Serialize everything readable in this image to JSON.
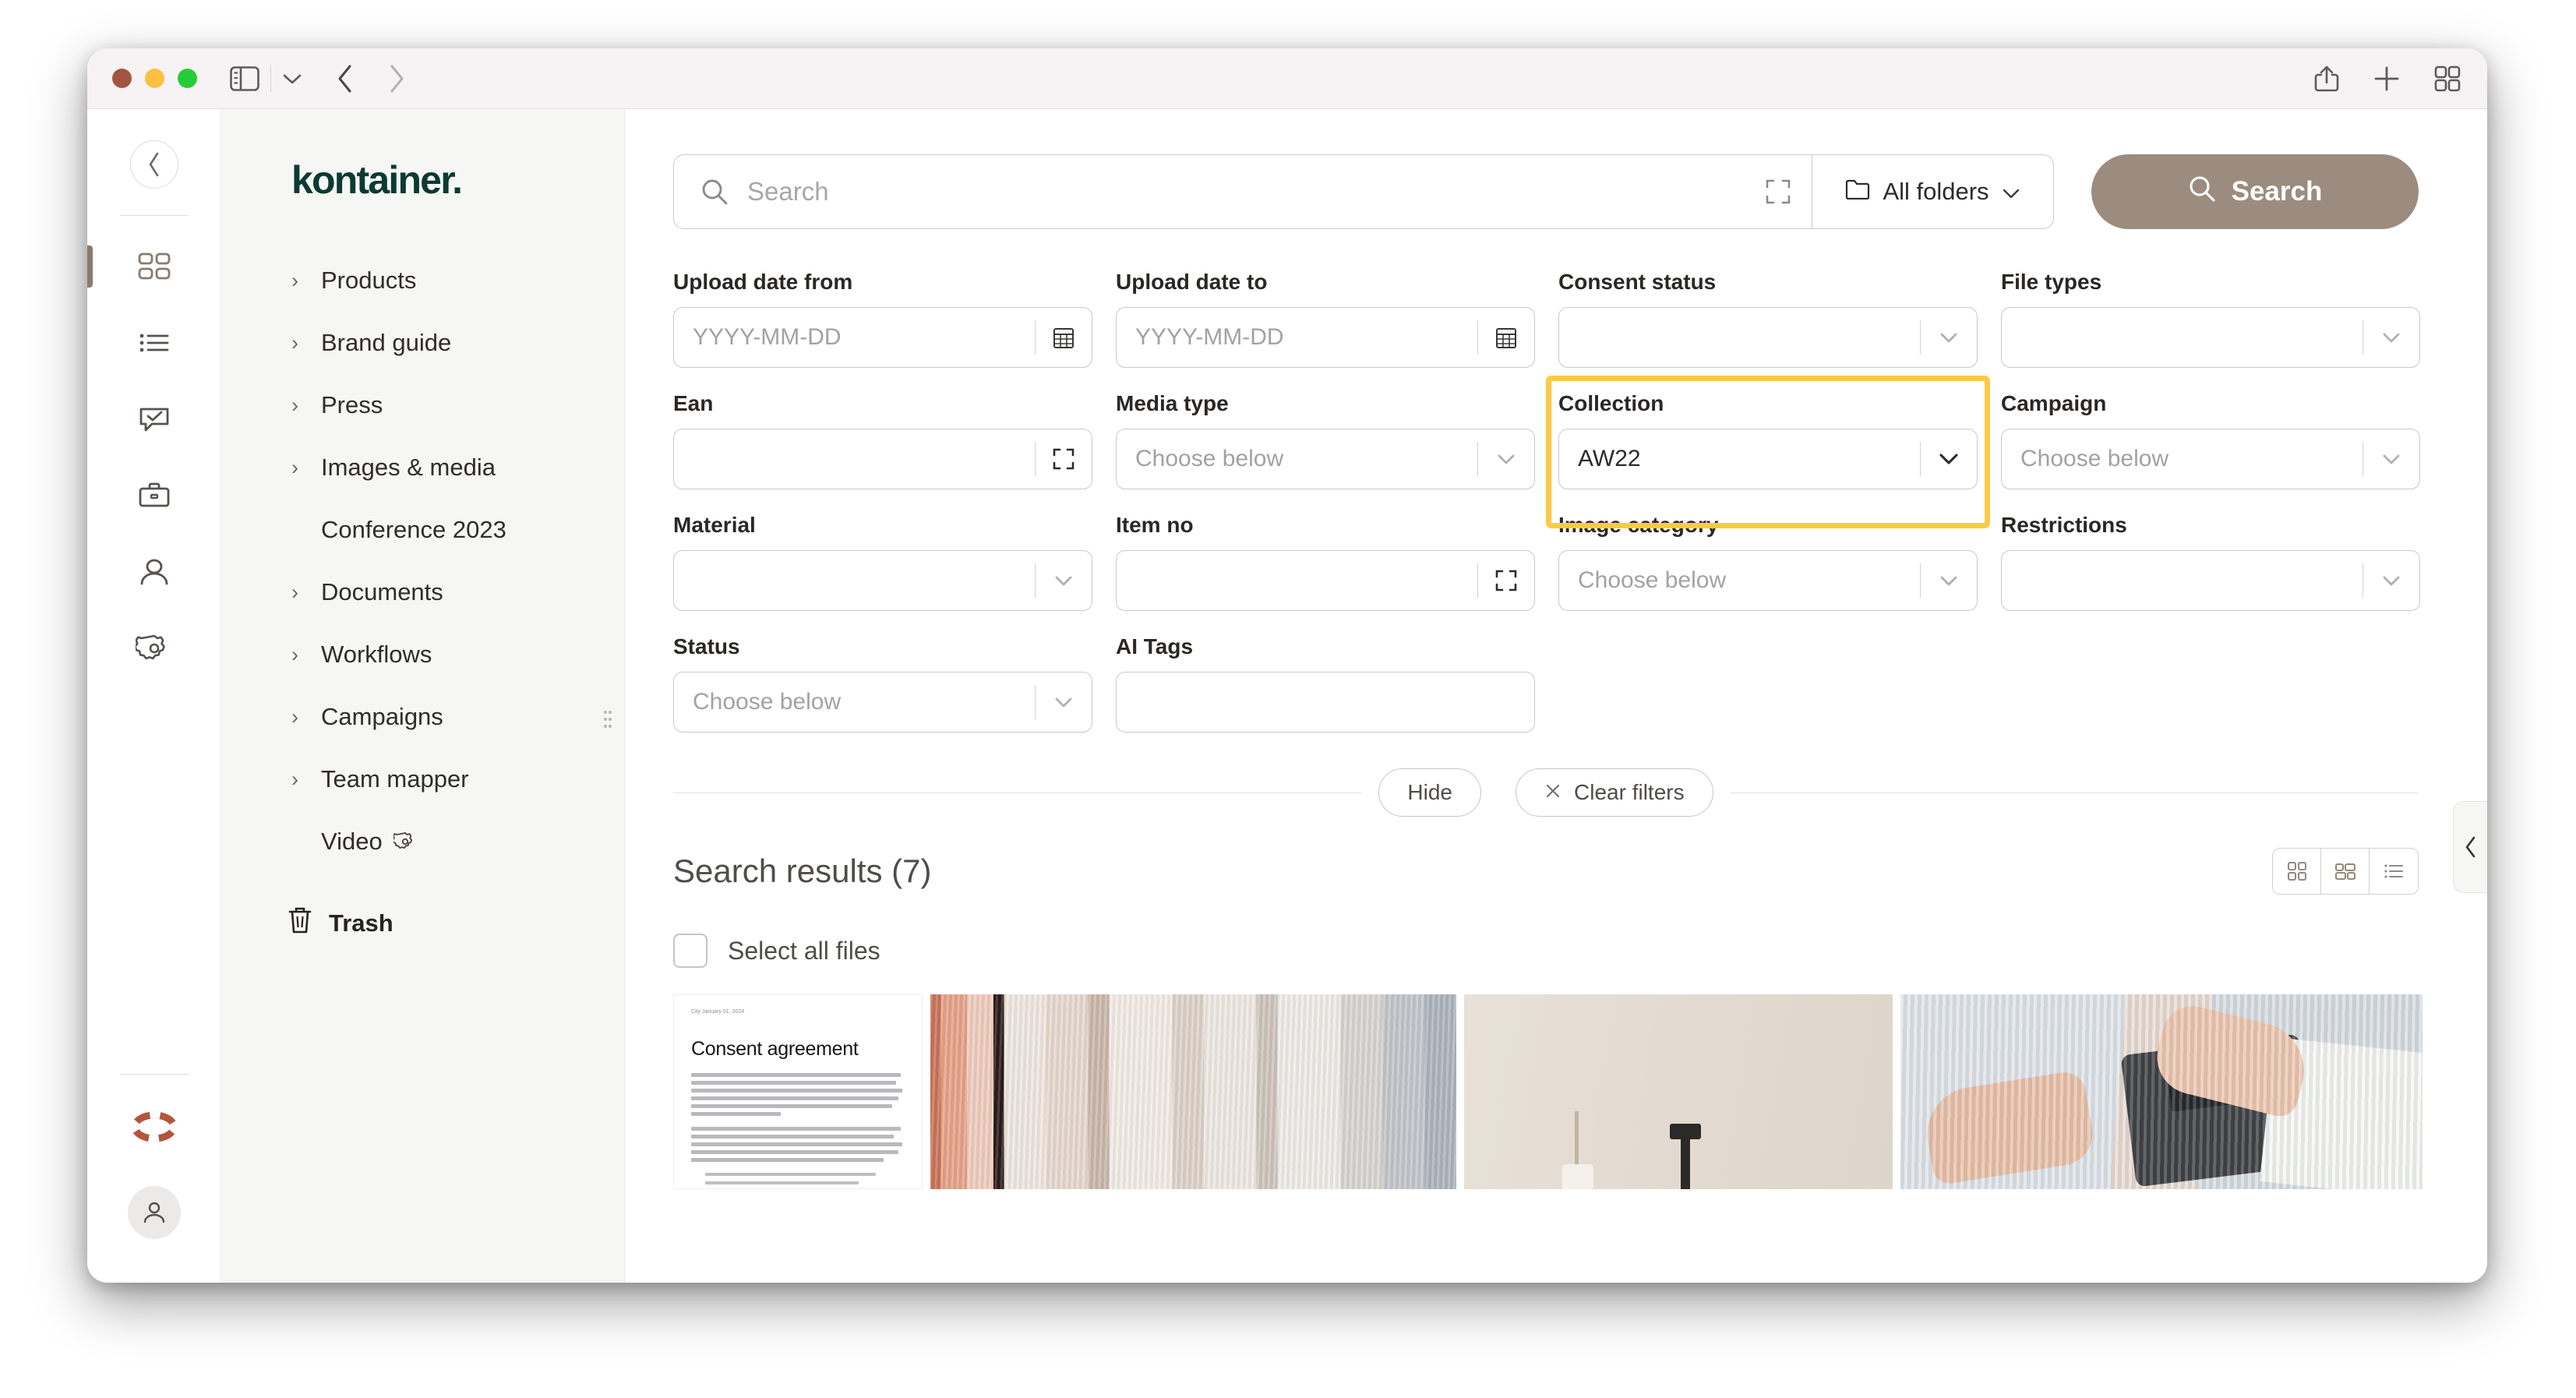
{
  "browser": {
    "traffic_lights": [
      "close",
      "minimize",
      "maximize"
    ],
    "sidebar_toggle_icon": "sidebar-icon",
    "sidebar_dropdown_icon": "chevron-down-icon",
    "back_icon": "chevron-left-icon",
    "forward_icon": "chevron-right-icon",
    "share_icon": "share-icon",
    "new_tab_icon": "plus-icon",
    "tab_overview_icon": "grid-icon"
  },
  "rail": {
    "collapse_icon": "chevron-left-icon",
    "items": [
      {
        "name": "dashboard",
        "icon": "grid-icon",
        "active": true
      },
      {
        "name": "lists",
        "icon": "list-icon",
        "active": false
      },
      {
        "name": "approvals",
        "icon": "comment-check-icon",
        "active": false
      },
      {
        "name": "briefcase",
        "icon": "briefcase-icon",
        "active": false
      },
      {
        "name": "users",
        "icon": "user-icon",
        "active": false
      },
      {
        "name": "settings",
        "icon": "gear-icon",
        "active": false
      }
    ],
    "support_icon": "lifebuoy-icon",
    "support_color": "#b3563c",
    "account_icon": "user-icon"
  },
  "sidebar": {
    "brand": "kontainer.",
    "brand_color": "#0c3a33",
    "items": [
      {
        "label": "Products",
        "expandable": true
      },
      {
        "label": "Brand guide",
        "expandable": true
      },
      {
        "label": "Press",
        "expandable": true
      },
      {
        "label": "Images & media",
        "expandable": true
      },
      {
        "label": "Conference 2023",
        "expandable": false
      },
      {
        "label": "Documents",
        "expandable": true
      },
      {
        "label": "Workflows",
        "expandable": true
      },
      {
        "label": "Campaigns",
        "expandable": true
      },
      {
        "label": "Team mapper",
        "expandable": true
      },
      {
        "label": "Video",
        "expandable": false,
        "gear": true
      }
    ],
    "trash": {
      "label": "Trash",
      "icon": "trash-icon"
    },
    "drag_handle_icon": "drag-dots-icon"
  },
  "search": {
    "placeholder": "Search",
    "value": "",
    "search_icon": "search-icon",
    "expand_icon": "expand-icon",
    "folder_icon": "folder-icon",
    "folder_label": "All folders",
    "folder_caret_icon": "chevron-down-icon",
    "button_label": "Search",
    "button_icon": "search-icon",
    "button_color": "#9b8c7f"
  },
  "filters": {
    "rows": [
      [
        {
          "label": "Upload date from",
          "value": "",
          "placeholder": "YYYY-MM-DD",
          "affix": "calendar-icon",
          "type": "date"
        },
        {
          "label": "Upload date to",
          "value": "",
          "placeholder": "YYYY-MM-DD",
          "affix": "calendar-icon",
          "type": "date"
        },
        {
          "label": "Consent status",
          "value": "",
          "placeholder": "",
          "affix": "chevron-down-icon",
          "type": "select"
        },
        {
          "label": "File types",
          "value": "",
          "placeholder": "",
          "affix": "chevron-down-icon",
          "type": "select"
        }
      ],
      [
        {
          "label": "Ean",
          "value": "",
          "placeholder": "",
          "affix": "expand-icon",
          "type": "text"
        },
        {
          "label": "Media type",
          "value": "",
          "placeholder": "Choose below",
          "affix": "chevron-down-icon",
          "type": "select"
        },
        {
          "label": "Collection",
          "value": "AW22",
          "placeholder": "",
          "affix": "chevron-down-icon",
          "type": "select",
          "highlighted": true
        },
        {
          "label": "Campaign",
          "value": "",
          "placeholder": "Choose below",
          "affix": "chevron-down-icon",
          "type": "select"
        }
      ],
      [
        {
          "label": "Material",
          "value": "",
          "placeholder": "",
          "affix": "chevron-down-icon",
          "type": "select"
        },
        {
          "label": "Item no",
          "value": "",
          "placeholder": "",
          "affix": "expand-icon",
          "type": "text"
        },
        {
          "label": "Image category",
          "value": "",
          "placeholder": "Choose below",
          "affix": "chevron-down-icon",
          "type": "select"
        },
        {
          "label": "Restrictions",
          "value": "",
          "placeholder": "",
          "affix": "chevron-down-icon",
          "type": "select"
        }
      ],
      [
        {
          "label": "Status",
          "value": "",
          "placeholder": "Choose below",
          "affix": "chevron-down-icon",
          "type": "select"
        },
        {
          "label": "AI Tags",
          "value": "",
          "placeholder": "",
          "affix": "",
          "type": "text"
        }
      ]
    ],
    "highlight_color": "#ffc944",
    "hide_label": "Hide",
    "clear_label": "Clear filters",
    "clear_icon": "close-icon"
  },
  "results": {
    "title": "Search results (7)",
    "views": [
      {
        "name": "grid-view",
        "icon": "grid-icon",
        "active": false
      },
      {
        "name": "masonry-view",
        "icon": "masonry-icon",
        "active": true
      },
      {
        "name": "list-view",
        "icon": "list-icon",
        "active": false
      }
    ],
    "select_all_label": "Select all files",
    "select_all_checked": false,
    "thumbnails": [
      {
        "name": "consent-agreement-document",
        "kind": "document",
        "doc_title": "Consent agreement",
        "doc_meta": "City January 01, 2024"
      },
      {
        "name": "knit-textiles-photo",
        "kind": "photo"
      },
      {
        "name": "dried-palm-vase-photo",
        "kind": "photo"
      },
      {
        "name": "hands-device-photo",
        "kind": "photo"
      }
    ]
  },
  "right_panel": {
    "toggle_icon": "chevron-left-icon"
  }
}
